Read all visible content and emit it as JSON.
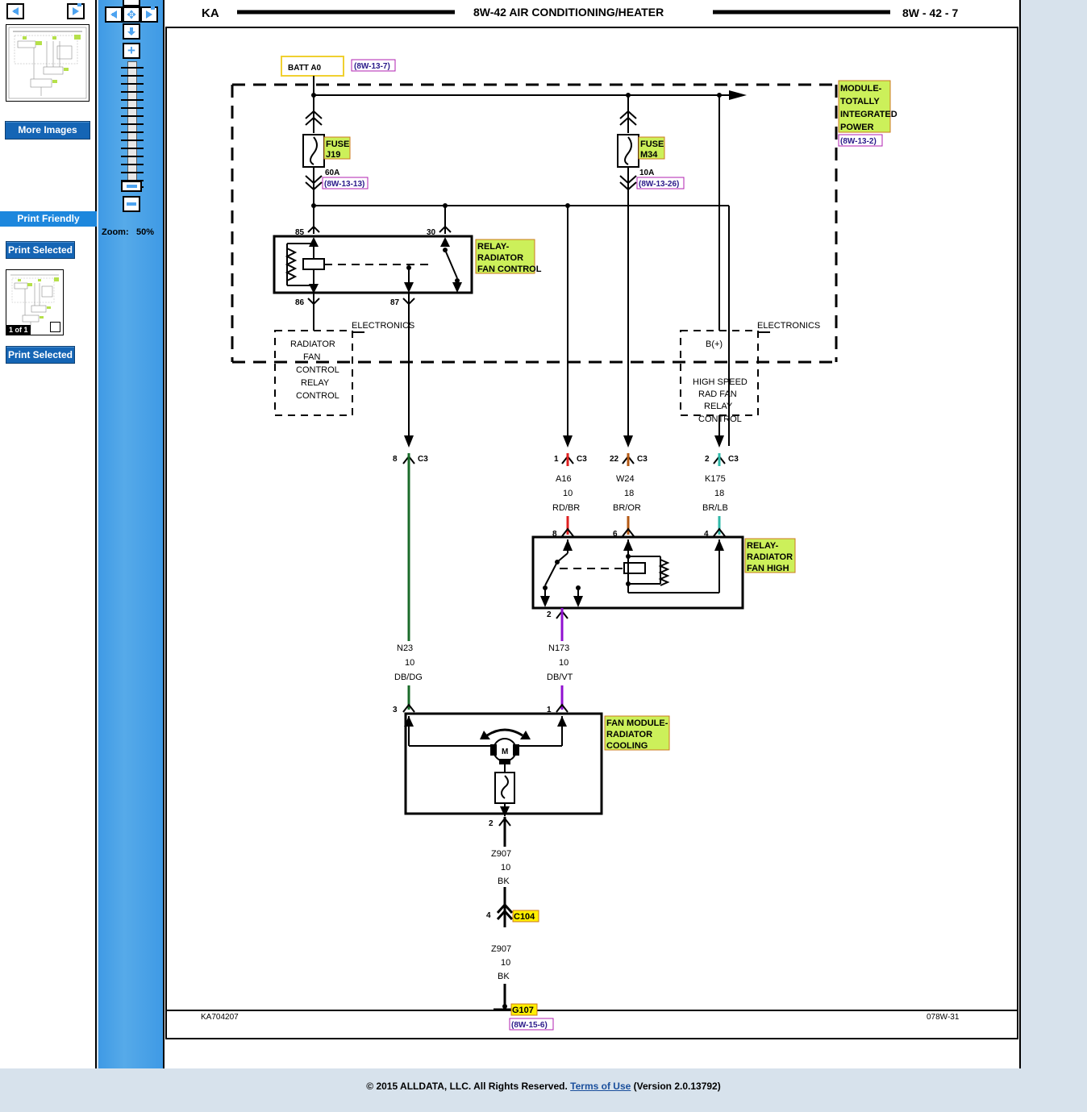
{
  "sidebar": {
    "prev_label": "◀",
    "next_label": "▶",
    "more_images_label": "More Images",
    "print_friendly_label": "Print Friendly",
    "print_selected_top_label": "Print Selected",
    "print_selected_bottom_label": "Print Selected",
    "page_counter": "1 of 1"
  },
  "zoom_panel": {
    "zoom_caption": "Zoom:",
    "zoom_value": "50%",
    "plus_label": "+",
    "minus_label": "−"
  },
  "diagram": {
    "header": {
      "left_code": "KA",
      "title": "8W-42 AIR CONDITIONING/HEATER",
      "page_number": "8W - 42 - 7"
    },
    "footer": {
      "left_code": "KA704207",
      "right_code": "078W-31"
    },
    "battery": {
      "label": "BATT A0",
      "ref": "(8W-13-7)"
    },
    "module_tipm": {
      "line1": "MODULE-",
      "line2": "TOTALLY",
      "line3": "INTEGRATED",
      "line4": "POWER",
      "ref": "(8W-13-2)"
    },
    "fuse_j19": {
      "line1": "FUSE",
      "line2": "J19",
      "amps": "60A",
      "ref": "(8W-13-13)"
    },
    "fuse_m34": {
      "line1": "FUSE",
      "line2": "M34",
      "amps": "10A",
      "ref": "(8W-13-26)"
    },
    "relay_fan_control": {
      "line1": "RELAY-",
      "line2": "RADIATOR",
      "line3": "FAN CONTROL",
      "pin_85": "85",
      "pin_30": "30",
      "pin_86": "86",
      "pin_87": "87"
    },
    "electronics_left": {
      "caption": "ELECTRONICS",
      "line1": "RADIATOR",
      "line2": "FAN",
      "line3": "CONTROL",
      "line4": "RELAY",
      "line5": "CONTROL"
    },
    "electronics_right": {
      "caption": "ELECTRONICS",
      "line0": "B(+)",
      "line1": "HIGH SPEED",
      "line2": "RAD FAN",
      "line3": "RELAY",
      "line4": "CONTROL"
    },
    "c3_connectors": [
      {
        "pin": "8",
        "label": "C3"
      },
      {
        "pin": "1",
        "label": "C3"
      },
      {
        "pin": "22",
        "label": "C3"
      },
      {
        "pin": "2",
        "label": "C3"
      }
    ],
    "wires_top": [
      {
        "id": "A16",
        "gauge": "10",
        "color_code": "RD/BR",
        "color": "#e02020"
      },
      {
        "id": "W24",
        "gauge": "18",
        "color_code": "BR/OR",
        "color": "#b45a14"
      },
      {
        "id": "K175",
        "gauge": "18",
        "color_code": "BR/LB",
        "color": "#2fb8a8"
      }
    ],
    "relay_fan_high": {
      "line1": "RELAY-",
      "line2": "RADIATOR",
      "line3": "FAN HIGH",
      "pin_8": "8",
      "pin_6": "6",
      "pin_4": "4",
      "pin_2": "2"
    },
    "wires_mid": [
      {
        "id": "N23",
        "gauge": "10",
        "color_code": "DB/DG",
        "color": "#1a6b2a"
      },
      {
        "id": "N173",
        "gauge": "10",
        "color_code": "DB/VT",
        "color": "#9010d0"
      }
    ],
    "fan_module": {
      "line1": "FAN MODULE-",
      "line2": "RADIATOR",
      "line3": "COOLING",
      "pin_3": "3",
      "pin_1": "1",
      "pin_2": "2",
      "motor_letter": "M"
    },
    "ground_path": {
      "wire_upper_id": "Z907",
      "wire_upper_gauge": "10",
      "wire_upper_color": "BK",
      "connector_pin": "4",
      "connector_label": "C104",
      "wire_lower_id": "Z907",
      "wire_lower_gauge": "10",
      "wire_lower_color": "BK",
      "ground_label": "G107",
      "ground_ref": "(8W-15-6)"
    }
  },
  "page_footer": {
    "copyright": "© 2015 ALLDATA, LLC. All Rights Reserved.",
    "terms_link": "Terms of Use",
    "version": "(Version 2.0.13792)"
  },
  "colors": {
    "panel_blue": "#4da3f0",
    "button_blue": "#1565b5",
    "band_blue": "#1d87dd",
    "page_bg": "#d7e2ec",
    "highlight_green": "#ccf05a",
    "highlight_yellow": "#ffef00",
    "ref_purple": "#2a1a8a"
  }
}
